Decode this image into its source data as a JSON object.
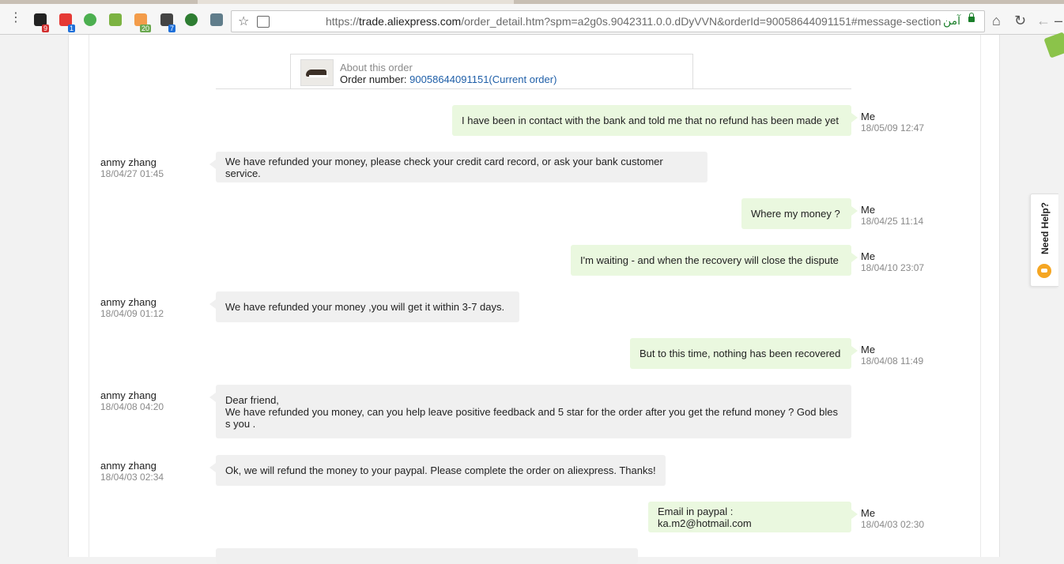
{
  "browser": {
    "url_protocol": "https://",
    "url_host": "trade.aliexpress.com",
    "url_path": "/order_detail.htm?spm=a2g0s.9042311.0.0.dDyVVN&orderId=90058644091151#message-section",
    "secure_label": "آمن",
    "extension_badges": [
      "9",
      "1",
      "20",
      "7"
    ]
  },
  "order": {
    "about_label": "About this order",
    "number_label": "Order number:",
    "number_value": "90058644091151(Current order)"
  },
  "messages": [
    {
      "side": "me",
      "sender": "Me",
      "time": "18/05/09 12:47",
      "text": "I have been in contact with the bank and told me that no refund has been made yet"
    },
    {
      "side": "them",
      "sender": "anmy zhang",
      "time": "18/04/27 01:45",
      "text": "We have refunded your money, please check your credit card record, or ask your bank customer service."
    },
    {
      "side": "me",
      "sender": "Me",
      "time": "18/04/25 11:14",
      "text": "Where my money ?"
    },
    {
      "side": "me",
      "sender": "Me",
      "time": "18/04/10 23:07",
      "text": "I'm waiting - and when the recovery will close the dispute"
    },
    {
      "side": "them",
      "sender": "anmy zhang",
      "time": "18/04/09 01:12",
      "text": "We have refunded your money ,you will get it within 3-7 days."
    },
    {
      "side": "me",
      "sender": "Me",
      "time": "18/04/08 11:49",
      "text": "But to this time, nothing has been recovered"
    },
    {
      "side": "them",
      "sender": "anmy zhang",
      "time": "18/04/08 04:20",
      "text": "Dear friend,\nWe have refunded you money, can you help leave positive feedback and 5 star for the order after you get the refund money ? God bles\ns you ."
    },
    {
      "side": "them",
      "sender": "anmy zhang",
      "time": "18/04/03 02:34",
      "text": "Ok, we will refund the money to your paypal. Please complete the order on aliexpress. Thanks!"
    },
    {
      "side": "me",
      "sender": "Me",
      "time": "18/04/03 02:30",
      "text": "Email in paypal :      ka.m2@hotmail.com"
    }
  ],
  "help_tab": {
    "label": "Need Help?"
  }
}
